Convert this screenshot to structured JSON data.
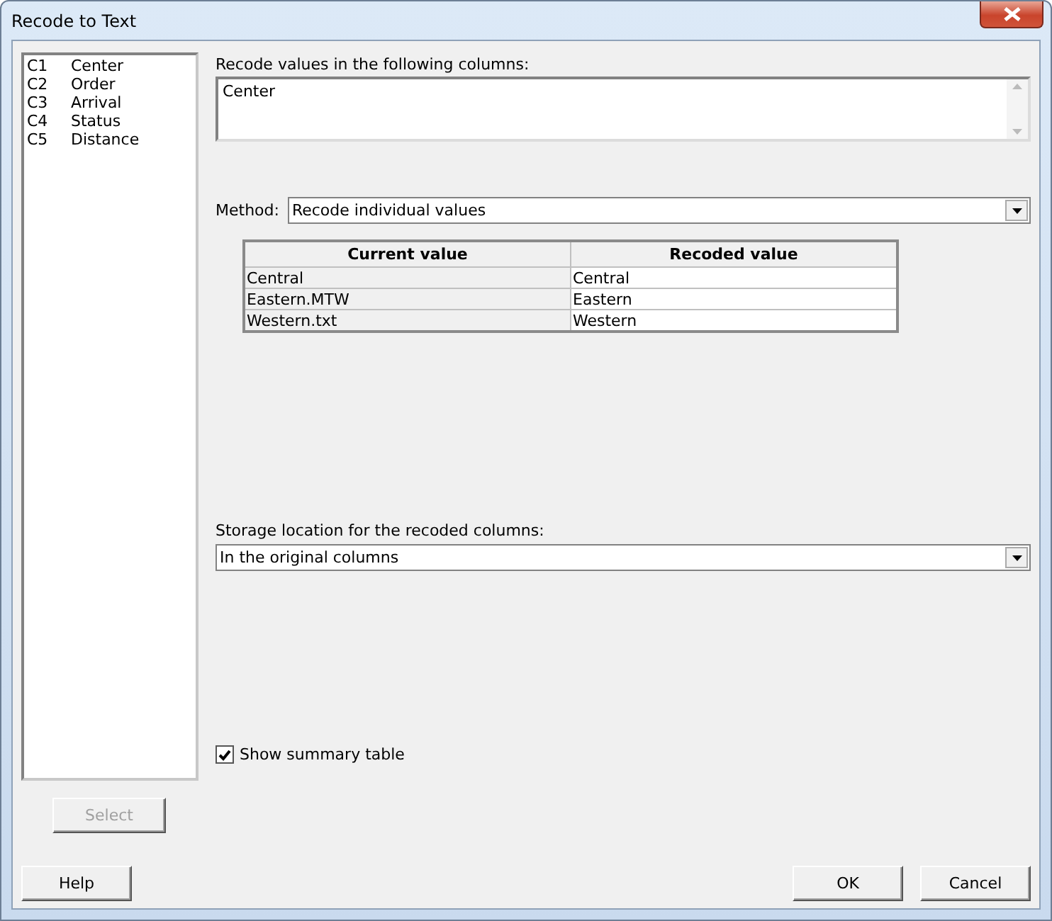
{
  "window": {
    "title": "Recode to Text"
  },
  "variables": [
    {
      "number": "C1",
      "name": "Center"
    },
    {
      "number": "C2",
      "name": "Order"
    },
    {
      "number": "C3",
      "name": "Arrival"
    },
    {
      "number": "C4",
      "name": "Status"
    },
    {
      "number": "C5",
      "name": "Distance"
    }
  ],
  "select_button": {
    "label": "Select",
    "disabled": true
  },
  "recode_columns": {
    "label": "Recode values in the following columns:",
    "value": "Center"
  },
  "method": {
    "label": "Method:",
    "value": "Recode individual values"
  },
  "table": {
    "columns": [
      "Current value",
      "Recoded value"
    ],
    "rows": [
      [
        "Central",
        "Central"
      ],
      [
        "Eastern.MTW",
        "Eastern"
      ],
      [
        "Western.txt",
        "Western"
      ]
    ]
  },
  "storage": {
    "label": "Storage location for the recoded columns:",
    "value": "In the original columns"
  },
  "show_summary": {
    "label": "Show summary table",
    "checked": true
  },
  "footer_left": [
    {
      "label": "Help"
    }
  ],
  "footer_right": [
    {
      "label": "OK"
    },
    {
      "label": "Cancel"
    }
  ]
}
